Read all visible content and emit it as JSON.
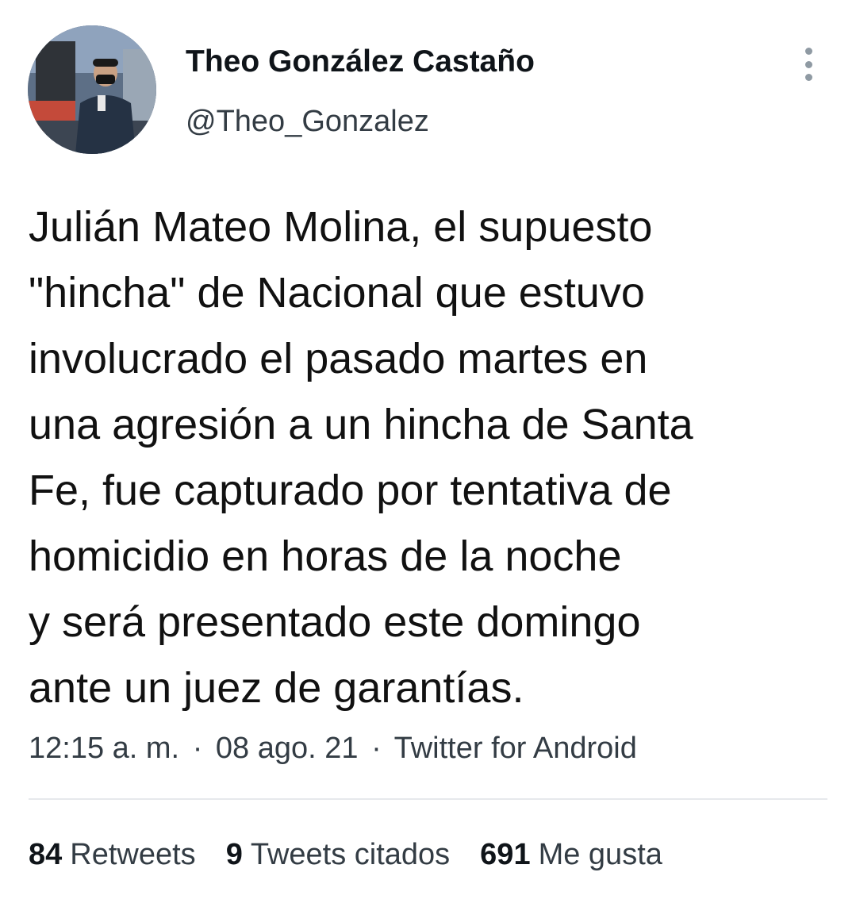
{
  "user": {
    "display_name": "Theo González Castaño",
    "handle": "@Theo_Gonzalez",
    "avatar_icon": "profile-photo"
  },
  "menu": {
    "icon": "vertical-ellipsis-icon"
  },
  "tweet": {
    "lines": [
      "Julián Mateo Molina, el supuesto",
      "\"hincha\" de Nacional que estuvo",
      "involucrado el pasado martes en",
      "una agresión a un hincha de Santa",
      "Fe, fue capturado por tentativa de",
      "homicidio en horas de la noche",
      "y será presentado este domingo",
      "ante un juez de garantías."
    ],
    "time": "12:15 a. m.",
    "separator": "·",
    "date": "08 ago. 21",
    "source": "Twitter for Android"
  },
  "stats": {
    "retweets_count": "84",
    "retweets_label": "Retweets",
    "quotes_count": "9",
    "quotes_label": "Tweets citados",
    "likes_count": "691",
    "likes_label": "Me gusta"
  },
  "colors": {
    "text_primary": "#0f1419",
    "text_secondary": "#333c44",
    "divider": "#e6e9ec",
    "menu_dots": "#8f9aa3"
  }
}
